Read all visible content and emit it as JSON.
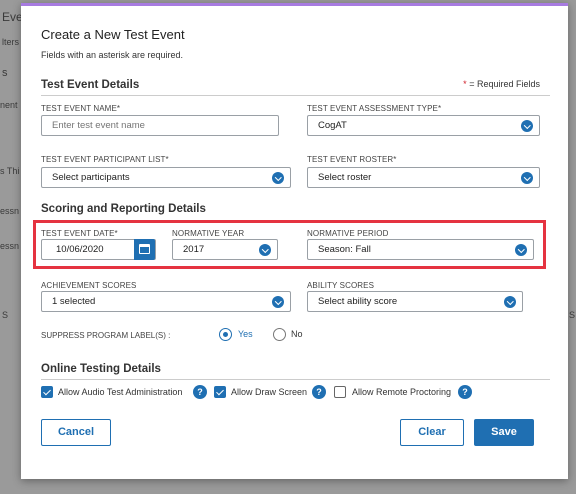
{
  "background": {
    "fragments": [
      "Eve",
      "lters",
      "s",
      "nent",
      "s Thi",
      "essn",
      "essn",
      "S",
      "S"
    ]
  },
  "modal": {
    "title": "Create a New Test Event",
    "subtitle": "Fields with an asterisk are required."
  },
  "details": {
    "heading": "Test Event Details",
    "required_note": "= Required Fields",
    "required_mark": "*",
    "name_label": "TEST EVENT NAME*",
    "name_placeholder": "Enter test event name",
    "assessment_type_label": "TEST EVENT ASSESSMENT TYPE*",
    "assessment_type_value": "CogAT",
    "participant_label": "TEST EVENT PARTICIPANT LIST*",
    "participant_value": "Select participants",
    "roster_label": "TEST EVENT ROSTER*",
    "roster_value": "Select roster"
  },
  "scoring": {
    "heading": "Scoring and Reporting Details",
    "date_label": "TEST EVENT DATE*",
    "date_value": "10/06/2020",
    "norm_year_label": "NORMATIVE YEAR",
    "norm_year_value": "2017",
    "norm_period_label": "NORMATIVE PERIOD",
    "norm_period_value": "Season: Fall",
    "achievement_label": "ACHIEVEMENT SCORES",
    "achievement_value": "1 selected",
    "ability_label": "ABILITY SCORES",
    "ability_value": "Select ability score",
    "suppress_label": "SUPPRESS PROGRAM LABEL(S) :",
    "yes_label": "Yes",
    "no_label": "No"
  },
  "online": {
    "heading": "Online Testing Details",
    "audio_label": "Allow Audio Test Administration",
    "draw_label": "Allow Draw Screen",
    "proctoring_label": "Allow Remote Proctoring",
    "help_glyph": "?"
  },
  "buttons": {
    "cancel": "Cancel",
    "clear": "Clear",
    "save": "Save"
  },
  "colors": {
    "accent": "#1f6fb2",
    "highlight": "#e53340",
    "required": "#d0202a"
  }
}
